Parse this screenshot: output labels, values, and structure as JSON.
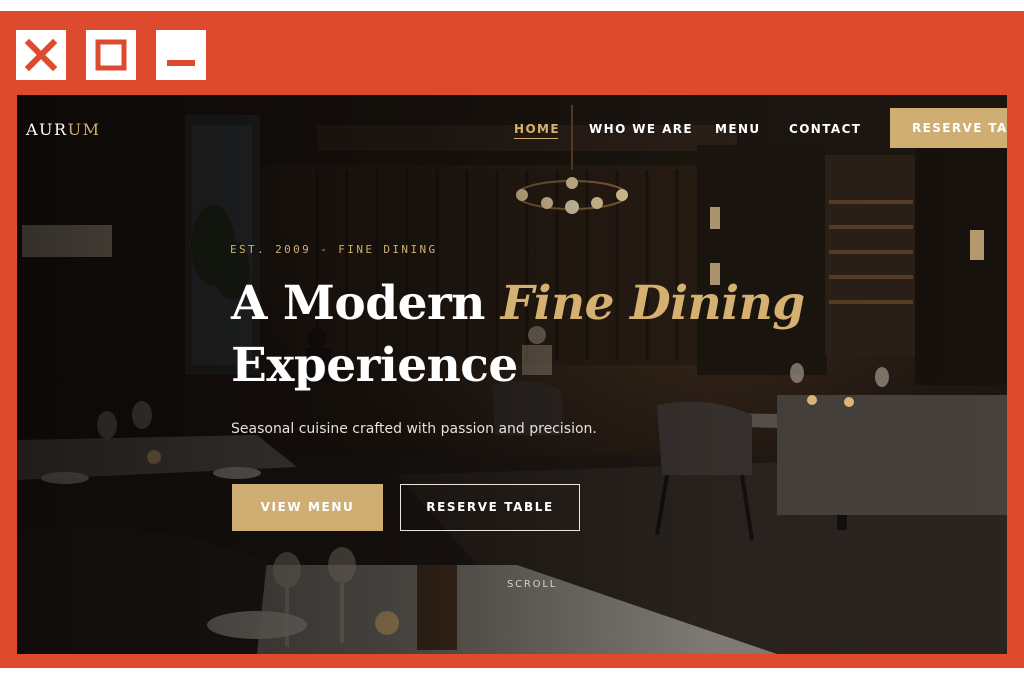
{
  "window": {
    "controls": [
      {
        "icon": "close-icon"
      },
      {
        "icon": "maximize-icon"
      },
      {
        "icon": "minimize-icon"
      }
    ],
    "frame_color": "#dd4a2e"
  },
  "site": {
    "logo": {
      "main": "AUR",
      "accent": "UM"
    },
    "nav": [
      {
        "label": "HOME",
        "active": true
      },
      {
        "label": "WHO WE ARE",
        "active": false
      },
      {
        "label": "MENU",
        "active": false
      },
      {
        "label": "CONTACT",
        "active": false
      }
    ],
    "reserve_button": "RESERVE TABLE",
    "accent_color": "#cfae74"
  },
  "hero": {
    "eyebrow": "EST. 2009 - FINE DINING",
    "headline": {
      "part1": "A Modern ",
      "highlight": "Fine Dining",
      "line2": "Experience"
    },
    "subtitle": "Seasonal cuisine crafted with passion and precision.",
    "primary_button": "VIEW MENU",
    "secondary_button": "RESERVE TABLE",
    "scroll_label": "SCROLL"
  }
}
